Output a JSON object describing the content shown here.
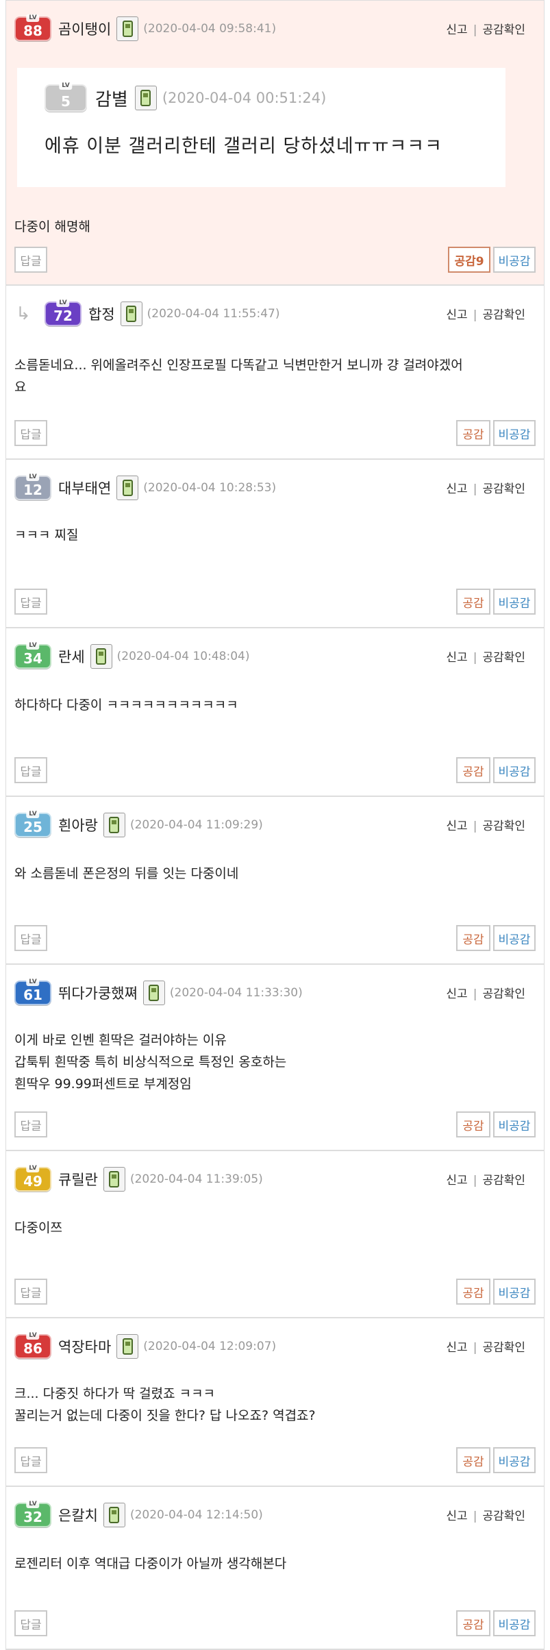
{
  "ui": {
    "report": "신고",
    "sep": "|",
    "sympathy_check": "공감확인",
    "reply": "답글",
    "like": "공감",
    "dislike": "비공감"
  },
  "comments": [
    {
      "level": "88",
      "level_color": "#d63a3a",
      "nick": "곰이탱이",
      "date": "(2020-04-04 09:58:41)",
      "quote": {
        "level": "5",
        "level_color": "#c8c8c8",
        "nick": "감별",
        "date": "(2020-04-04 00:51:24)",
        "text": "에휴 이분 갤러리한테 갤러리 당하셨네ㅠㅠㅋㅋㅋ"
      },
      "text": [
        "다중이 해명해"
      ],
      "like_label": "공감9",
      "best": true
    },
    {
      "level": "72",
      "level_color": "#6a3fc4",
      "nick": "합정",
      "date": "(2020-04-04 11:55:47)",
      "reply_arrow": "↳",
      "text": [
        "소름돋네요... 위에올려주신 인장프로필 다똑같고 닉변만한거 보니까 걍 걸려야겠어",
        "요"
      ]
    },
    {
      "level": "12",
      "level_color": "#9aa3b5",
      "nick": "대부태연",
      "date": "(2020-04-04 10:28:53)",
      "text": [
        "ㅋㅋㅋ 찌질"
      ]
    },
    {
      "level": "34",
      "level_color": "#5bb86a",
      "nick": "란세",
      "date": "(2020-04-04 10:48:04)",
      "text": [
        "하다하다 다중이 ㅋㅋㅋㅋㅋㅋㅋㅋㅋㅋㅋ"
      ]
    },
    {
      "level": "25",
      "level_color": "#6fb4d8",
      "nick": "흰아랑",
      "date": "(2020-04-04 11:09:29)",
      "text": [
        "와 소름돋네 폰은정의 뒤를 잇는 다중이네"
      ]
    },
    {
      "level": "61",
      "level_color": "#2f6fc4",
      "nick": "뛰다가쿵했쪄",
      "date": "(2020-04-04 11:33:30)",
      "text": [
        "이게 바로 인벤 흰딱은 걸러야하는 이유",
        "갑툭튀 흰딱중 특히 비상식적으로 특정인 옹호하는",
        "흰딱우 99.99퍼센트로 부계정임"
      ]
    },
    {
      "level": "49",
      "level_color": "#e0b020",
      "nick": "큐릴란",
      "date": "(2020-04-04 11:39:05)",
      "text": [
        "다중이쯔"
      ]
    },
    {
      "level": "86",
      "level_color": "#d63a3a",
      "nick": "역장타마",
      "date": "(2020-04-04 12:09:07)",
      "text": [
        "크... 다중짓 하다가 딱 걸렸죠 ㅋㅋㅋ",
        "꿀리는거 없는데 다중이 짓을 한다? 답 나오죠? 역겹죠?"
      ]
    },
    {
      "level": "32",
      "level_color": "#5bb86a",
      "nick": "은칼치",
      "date": "(2020-04-04 12:14:50)",
      "text": [
        "로젠리터 이후 역대급 다중이가 아닐까 생각해본다"
      ]
    }
  ]
}
